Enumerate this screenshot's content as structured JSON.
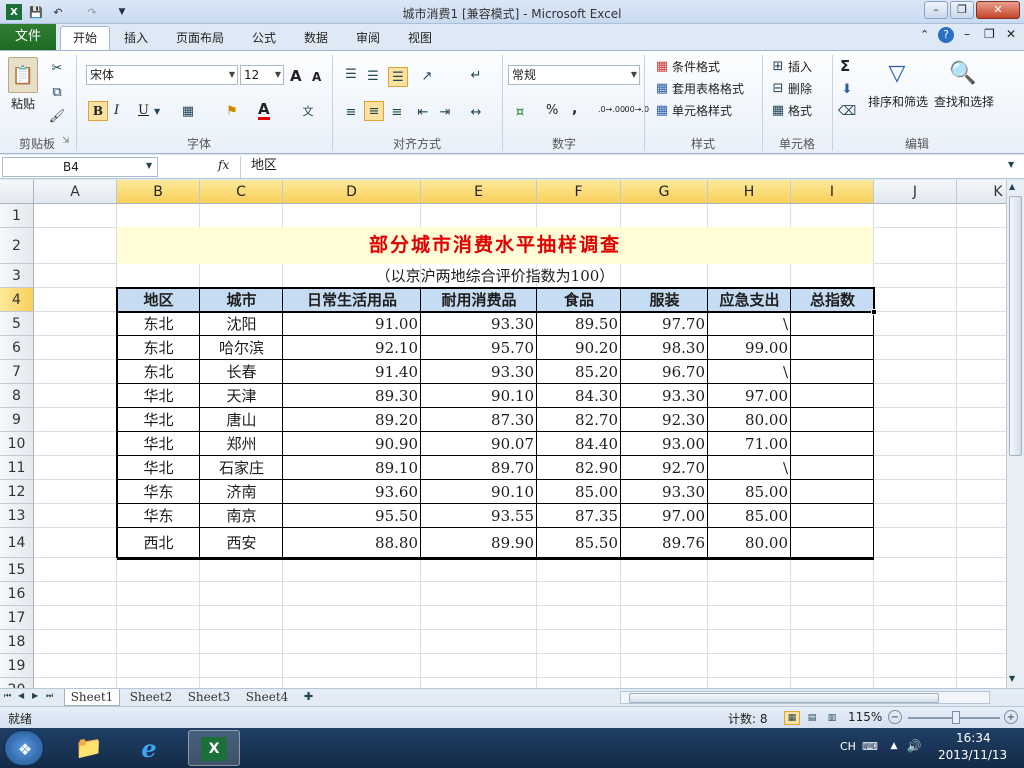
{
  "window": {
    "title": "城市消费1  [兼容模式] - Microsoft Excel",
    "controls": [
      "–",
      "❐",
      "✕"
    ],
    "doc_controls": [
      "–",
      "❐",
      "✕"
    ]
  },
  "tabs": [
    {
      "label": "文件"
    },
    {
      "label": "开始"
    },
    {
      "label": "插入"
    },
    {
      "label": "页面布局"
    },
    {
      "label": "公式"
    },
    {
      "label": "数据"
    },
    {
      "label": "审阅"
    },
    {
      "label": "视图"
    }
  ],
  "ribbon": {
    "clipboard": {
      "paste": "粘贴",
      "label": "剪贴板"
    },
    "font": {
      "name": "宋体",
      "size": "12",
      "label": "字体",
      "bold": "B",
      "italic": "I",
      "underline": "U",
      "grow": "A",
      "shrink": "A",
      "font_color": "A"
    },
    "align": {
      "label": "对齐方式"
    },
    "number": {
      "format": "常规",
      "label": "数字",
      "percent": "%",
      "comma": ",",
      "inc": ".0→.00",
      "dec": ".00→.0"
    },
    "styles": {
      "conditional": "条件格式",
      "table": "套用表格格式",
      "cell": "单元格样式",
      "label": "样式"
    },
    "cells": {
      "insert": "插入",
      "delete": "删除",
      "format": "格式",
      "label": "单元格"
    },
    "edit": {
      "sum": "Σ",
      "sort": "排序和筛选",
      "find": "查找和选择",
      "label": "编辑"
    }
  },
  "formula_bar": {
    "name_box": "B4",
    "fx": "fx",
    "content": "地区"
  },
  "columns": [
    {
      "label": "A"
    },
    {
      "label": "B",
      "sel": true
    },
    {
      "label": "C",
      "sel": true
    },
    {
      "label": "D",
      "sel": true
    },
    {
      "label": "E",
      "sel": true
    },
    {
      "label": "F",
      "sel": true
    },
    {
      "label": "G",
      "sel": true
    },
    {
      "label": "H",
      "sel": true
    },
    {
      "label": "I",
      "sel": true
    },
    {
      "label": "J"
    },
    {
      "label": "K"
    }
  ],
  "row_numbers": [
    "1",
    "2",
    "3",
    "4",
    "5",
    "6",
    "7",
    "8",
    "9",
    "10",
    "11",
    "12",
    "13",
    "14",
    "15",
    "16",
    "17",
    "18",
    "19",
    "20"
  ],
  "sheet": {
    "title": "部分城市消费水平抽样调查",
    "subtitle": "（以京沪两地综合评价指数为100）",
    "headers": [
      "地区",
      "城市",
      "日常生活用品",
      "耐用消费品",
      "食品",
      "服装",
      "应急支出",
      "总指数"
    ],
    "rows": [
      [
        "东北",
        "沈阳",
        "91.00",
        "93.30",
        "89.50",
        "97.70",
        "\\",
        ""
      ],
      [
        "东北",
        "哈尔滨",
        "92.10",
        "95.70",
        "90.20",
        "98.30",
        "99.00",
        ""
      ],
      [
        "东北",
        "长春",
        "91.40",
        "93.30",
        "85.20",
        "96.70",
        "\\",
        ""
      ],
      [
        "华北",
        "天津",
        "89.30",
        "90.10",
        "84.30",
        "93.30",
        "97.00",
        ""
      ],
      [
        "华北",
        "唐山",
        "89.20",
        "87.30",
        "82.70",
        "92.30",
        "80.00",
        ""
      ],
      [
        "华北",
        "郑州",
        "90.90",
        "90.07",
        "84.40",
        "93.00",
        "71.00",
        ""
      ],
      [
        "华北",
        "石家庄",
        "89.10",
        "89.70",
        "82.90",
        "92.70",
        "\\",
        ""
      ],
      [
        "华东",
        "济南",
        "93.60",
        "90.10",
        "85.00",
        "93.30",
        "85.00",
        ""
      ],
      [
        "华东",
        "南京",
        "95.50",
        "93.55",
        "87.35",
        "97.00",
        "85.00",
        ""
      ],
      [
        "西北",
        "西安",
        "88.80",
        "89.90",
        "85.50",
        "89.76",
        "80.00",
        ""
      ]
    ]
  },
  "sheet_tabs": [
    {
      "label": "Sheet1",
      "active": true
    },
    {
      "label": "Sheet2"
    },
    {
      "label": "Sheet3"
    },
    {
      "label": "Sheet4"
    }
  ],
  "status": {
    "ready": "就绪",
    "count": "计数: 8",
    "zoom": "115%"
  },
  "taskbar": {
    "lang": "CH",
    "time": "16:34",
    "date": "2013/11/13"
  },
  "colors": {
    "title_red": "#e00000",
    "title_fill": "#fffcd6",
    "header_fill": "#c5dcf2",
    "selected_header": "#f8cf5a",
    "file_tab": "#2f7d32"
  }
}
